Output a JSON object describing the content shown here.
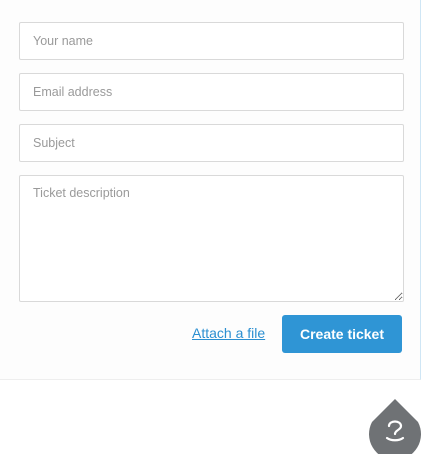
{
  "form": {
    "name_placeholder": "Your name",
    "email_placeholder": "Email address",
    "subject_placeholder": "Subject",
    "description_placeholder": "Ticket description",
    "attach_label": "Attach a file",
    "submit_label": "Create ticket"
  },
  "launcher": {
    "icon": "help-bubble-icon"
  },
  "colors": {
    "accent": "#2f95d5",
    "link": "#2b8fd1",
    "launcher_bg": "#6f7275",
    "field_border": "#d9d9d9",
    "placeholder": "#9a9a9a"
  }
}
